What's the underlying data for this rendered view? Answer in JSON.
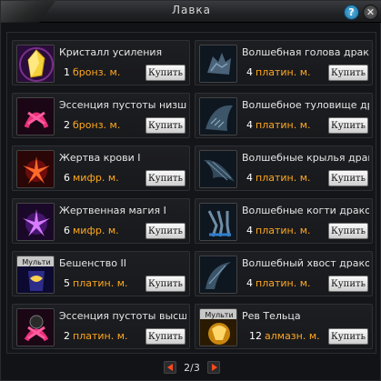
{
  "window": {
    "title": "Лавка",
    "help_label": "?",
    "close_label": "✕"
  },
  "items": [
    {
      "name": "Кристалл усиления",
      "count": "1",
      "currency": "бронз. м.",
      "buy": "Купить",
      "icon": "gem-crystal-icon"
    },
    {
      "name": "Волшебная голова дракона",
      "count": "4",
      "currency": "платин. м.",
      "buy": "Купить",
      "icon": "dragon-head-icon"
    },
    {
      "name": "Эссенция пустоты низшая",
      "count": "2",
      "currency": "бронз. м.",
      "buy": "Купить",
      "icon": "void-essence-low-icon"
    },
    {
      "name": "Волшебное туловище дракона",
      "count": "4",
      "currency": "платин. м.",
      "buy": "Купить",
      "icon": "dragon-body-icon"
    },
    {
      "name": "Жертва крови I",
      "count": "6",
      "currency": "мифр. м.",
      "buy": "Купить",
      "icon": "blood-sacrifice-icon"
    },
    {
      "name": "Волшебные крылья дракона",
      "count": "4",
      "currency": "платин. м.",
      "buy": "Купить",
      "icon": "dragon-wings-icon"
    },
    {
      "name": "Жертвенная магия I",
      "count": "6",
      "currency": "мифр. м.",
      "buy": "Купить",
      "icon": "sacrificial-magic-icon"
    },
    {
      "name": "Волшебные когти дракона",
      "count": "4",
      "currency": "платин. м.",
      "buy": "Купить",
      "icon": "dragon-claws-icon"
    },
    {
      "name": "Бешенство II",
      "count": "5",
      "currency": "платин. м.",
      "buy": "Купить",
      "icon": "fury-scroll-icon",
      "badge": "Мульти"
    },
    {
      "name": "Волшебный хвост дракона",
      "count": "4",
      "currency": "платин. м.",
      "buy": "Купить",
      "icon": "dragon-tail-icon"
    },
    {
      "name": "Эссенция пустоты высшая",
      "count": "2",
      "currency": "платин. м.",
      "buy": "Купить",
      "icon": "void-essence-high-icon"
    },
    {
      "name": "Рев Тельца",
      "count": "12",
      "currency": "алмазн. м.",
      "buy": "Купить",
      "icon": "taurus-roar-icon",
      "badge": "Мульти"
    }
  ],
  "pager": {
    "label": "2/3"
  },
  "colors": {
    "currency": "#ffa81e",
    "pager_arrow": "#ff4a1a",
    "help_button": "#3a9fd6"
  }
}
